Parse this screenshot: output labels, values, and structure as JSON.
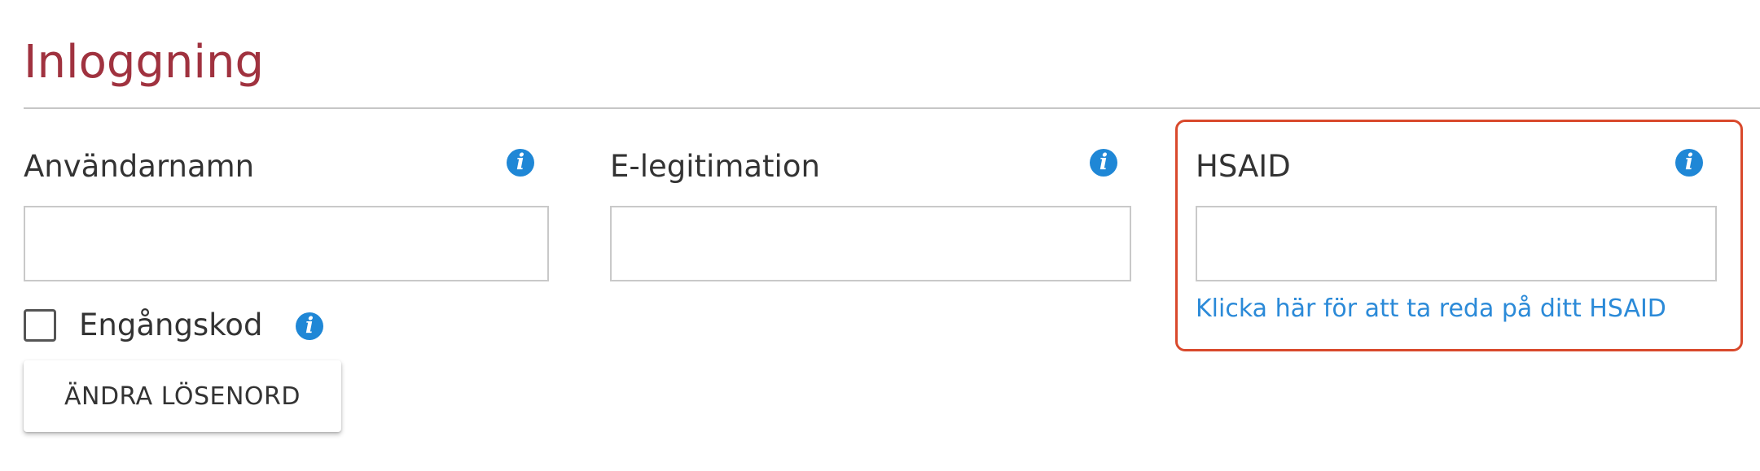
{
  "section": {
    "title": "Inloggning"
  },
  "fields": [
    {
      "label": "Användarnamn",
      "value": "",
      "placeholder": ""
    },
    {
      "label": "E-legitimation",
      "value": "",
      "placeholder": ""
    },
    {
      "label": "HSAID",
      "value": "",
      "placeholder": ""
    }
  ],
  "info_icon": {
    "glyph": "i",
    "icon": "info-icon",
    "color": "#1f87d6"
  },
  "hsaid_help_link": "Klicka här för att ta reda på ditt HSAID",
  "checkbox": {
    "label": "Engångskod",
    "checked": false
  },
  "change_password_button": "ÄNDRA LÖSENORD",
  "colors": {
    "title": "#a0323f",
    "link": "#2b8ad8",
    "highlight_border": "#d9492c"
  }
}
